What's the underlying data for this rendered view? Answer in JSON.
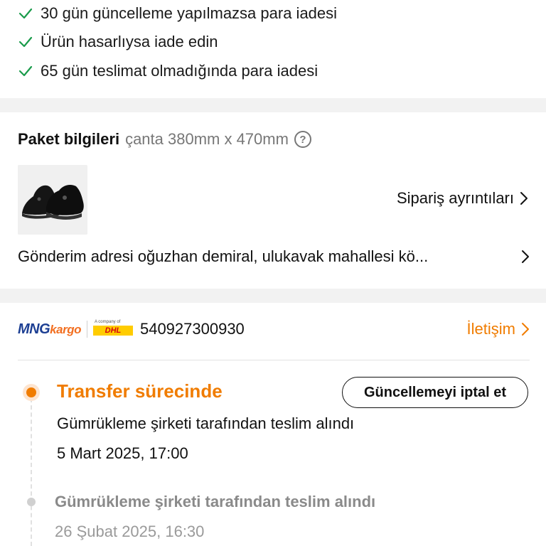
{
  "guarantees": [
    {
      "icon": "check-icon",
      "text": "30 gün güncelleme yapılmazsa para iadesi"
    },
    {
      "icon": "check-icon",
      "text": "Ürün hasarlıysa iade edin"
    },
    {
      "icon": "check-icon",
      "text": "65 gün teslimat olmadığında para iadesi"
    }
  ],
  "package": {
    "title": "Paket bilgileri",
    "size": "çanta 380mm x 470mm",
    "help_icon": "question-circle-icon",
    "order_details_label": "Sipariş ayrıntıları",
    "address_label": "Gönderim adresi oğuzhan demiral, ulukavak mahallesi kö..."
  },
  "shipping": {
    "carrier_logo": {
      "main": "MNG",
      "sub": "kargo"
    },
    "partner_logo": {
      "small": "A company of",
      "name": "DHL"
    },
    "tracking_number": "540927300930",
    "contact_label": "İletişim"
  },
  "timeline": {
    "current": {
      "status": "Transfer sürecinde",
      "action_label": "Güncellemeyi iptal et",
      "description": "Gümrükleme şirketi tarafından teslim alındı",
      "time": "5 Mart 2025, 17:00"
    },
    "previous": {
      "description": "Gümrükleme şirketi tarafından teslim alındı",
      "time": "26 Şubat 2025, 16:30"
    }
  },
  "colors": {
    "accent": "#f07c00",
    "check": "#1a9b4b",
    "mng_blue": "#1d3f93",
    "dhl_yellow": "#ffcc00",
    "dhl_red": "#d40511"
  }
}
